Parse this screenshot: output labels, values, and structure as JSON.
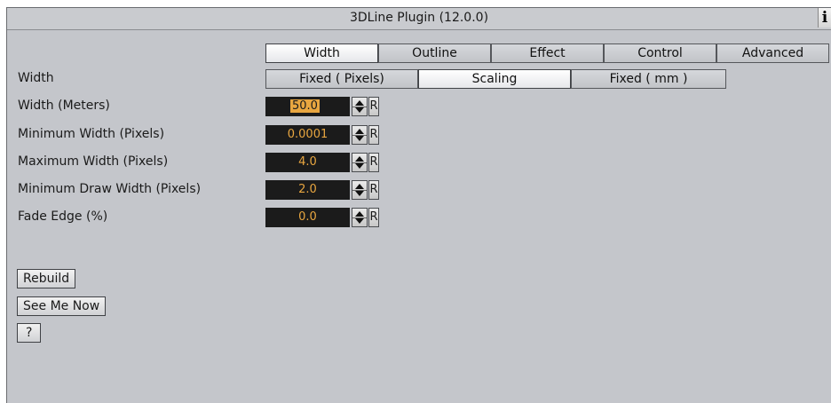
{
  "title": "3DLine Plugin (12.0.0)",
  "info_icon": "info-icon",
  "tabs": [
    {
      "label": "Width",
      "active": true
    },
    {
      "label": "Outline",
      "active": false
    },
    {
      "label": "Effect",
      "active": false
    },
    {
      "label": "Control",
      "active": false
    },
    {
      "label": "Advanced",
      "active": false
    }
  ],
  "width_mode": {
    "label": "Width",
    "options": [
      "Fixed ( Pixels)",
      "Scaling",
      "Fixed ( mm )"
    ],
    "selected": "Scaling"
  },
  "params": [
    {
      "label": "Width (Meters)",
      "value": "50.0",
      "reset": "R",
      "selected": true
    },
    {
      "label": "Minimum Width (Pixels)",
      "value": "0.0001",
      "reset": "R"
    },
    {
      "label": "Maximum Width (Pixels)",
      "value": "4.0",
      "reset": "R"
    },
    {
      "label": "Minimum Draw Width (Pixels)",
      "value": "2.0",
      "reset": "R"
    },
    {
      "label": "Fade Edge (%)",
      "value": "0.0",
      "reset": "R"
    }
  ],
  "buttons": {
    "rebuild": "Rebuild",
    "see_me_now": "See Me Now",
    "help": "?"
  },
  "colors": {
    "panel_bg": "#c4c6cb",
    "field_bg": "#1b1b1b",
    "field_text": "#e8a640"
  }
}
